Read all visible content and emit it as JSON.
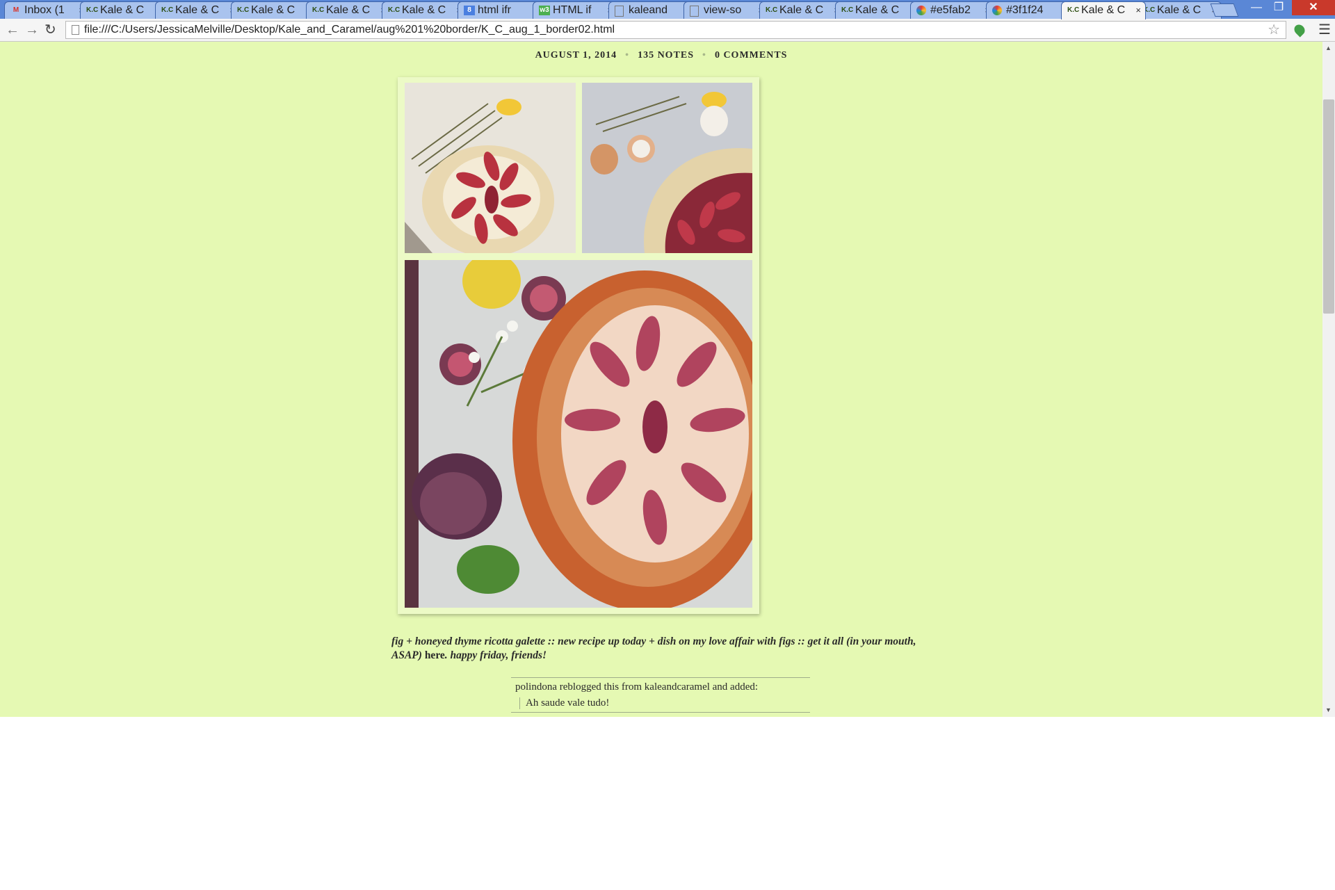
{
  "browser": {
    "tabs": [
      {
        "favicon": "gmail-icon",
        "title": "Inbox (1",
        "active": false
      },
      {
        "favicon": "K.C",
        "title": "Kale & C",
        "active": false
      },
      {
        "favicon": "K.C",
        "title": "Kale & C",
        "active": false
      },
      {
        "favicon": "K.C",
        "title": "Kale & C",
        "active": false
      },
      {
        "favicon": "K.C",
        "title": "Kale & C",
        "active": false
      },
      {
        "favicon": "K.C",
        "title": "Kale & C",
        "active": false
      },
      {
        "favicon": "google-icon",
        "title": "html ifr",
        "active": false
      },
      {
        "favicon": "w3-icon",
        "title": "HTML if",
        "active": false
      },
      {
        "favicon": "page-icon",
        "title": "kaleand",
        "active": false
      },
      {
        "favicon": "page-icon",
        "title": "view-so",
        "active": false
      },
      {
        "favicon": "K.C",
        "title": "Kale & C",
        "active": false
      },
      {
        "favicon": "K.C",
        "title": "Kale & C",
        "active": false
      },
      {
        "favicon": "color-icon",
        "title": "#e5fab2",
        "active": false
      },
      {
        "favicon": "color-icon",
        "title": "#3f1f24",
        "active": false
      },
      {
        "favicon": "K.C",
        "title": "Kale & C",
        "active": true
      },
      {
        "favicon": "K.C",
        "title": "Kale & C",
        "active": false
      }
    ],
    "url": "file:///C:/Users/JessicaMelville/Desktop/Kale_and_Caramel/aug%201%20border/K_C_aug_1_border02.html"
  },
  "post": {
    "date": "AUGUST 1, 2014",
    "notes": "135 NOTES",
    "comments": "0 COMMENTS",
    "caption_text": "fig + honeyed thyme ricotta galette :: new recipe up today + dish on my love affair with figs :: get it all (in your mouth, ASAP) ",
    "caption_link": "here",
    "caption_end": ". happy friday, friends!",
    "reblog": {
      "line": "polindona reblogged this from kaleandcaramel and added:",
      "quote": "Ah saude vale tudo!"
    }
  },
  "colors": {
    "page_background": "#e5f9b3",
    "text": "#2a2a2a",
    "tab_bar": "#5a87d6",
    "close_button": "#c9392b"
  }
}
